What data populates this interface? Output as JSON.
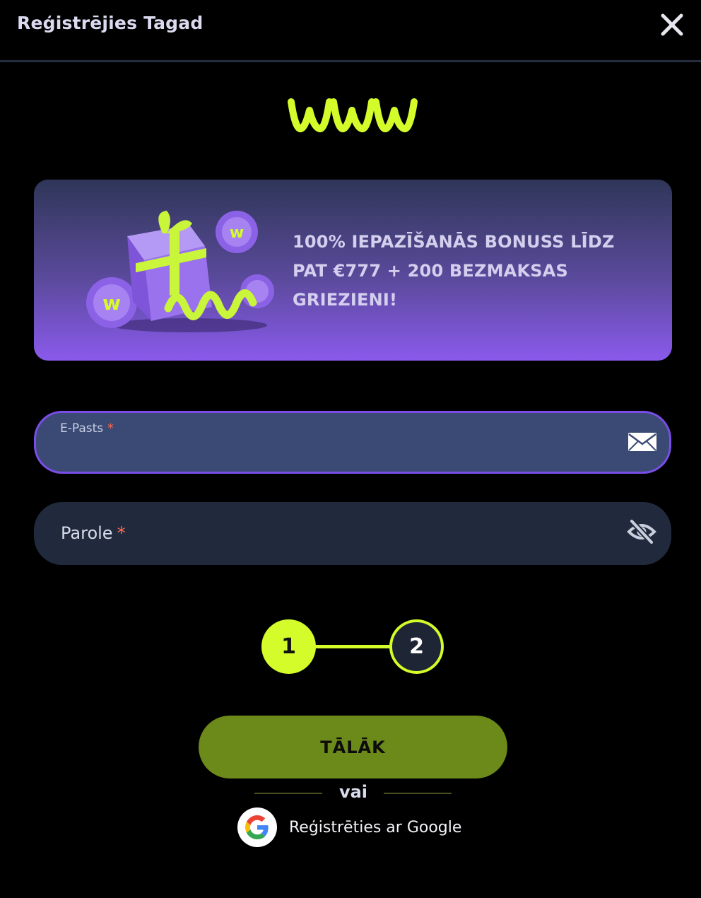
{
  "header": {
    "title": "Reģistrējies Tagad"
  },
  "banner": {
    "text": "100% IEPAZĪŠANĀS BONUSS LĪDZ PAT €777 + 200 BEZMAKSAS GRIEZIENI!"
  },
  "form": {
    "email": {
      "label": "E-Pasts",
      "required_mark": "*",
      "value": ""
    },
    "password": {
      "label": "Parole",
      "required_mark": "*",
      "value": ""
    }
  },
  "stepper": {
    "steps": [
      "1",
      "2"
    ],
    "current": 1
  },
  "actions": {
    "next_label": "TĀLĀK",
    "or_label": "vai",
    "google_label": "Reģistrēties ar Google"
  },
  "colors": {
    "accent": "#d4fb2a",
    "button": "#6b8a19",
    "banner_bottom": "#8a5aec",
    "focus_border": "#7a4de8"
  }
}
